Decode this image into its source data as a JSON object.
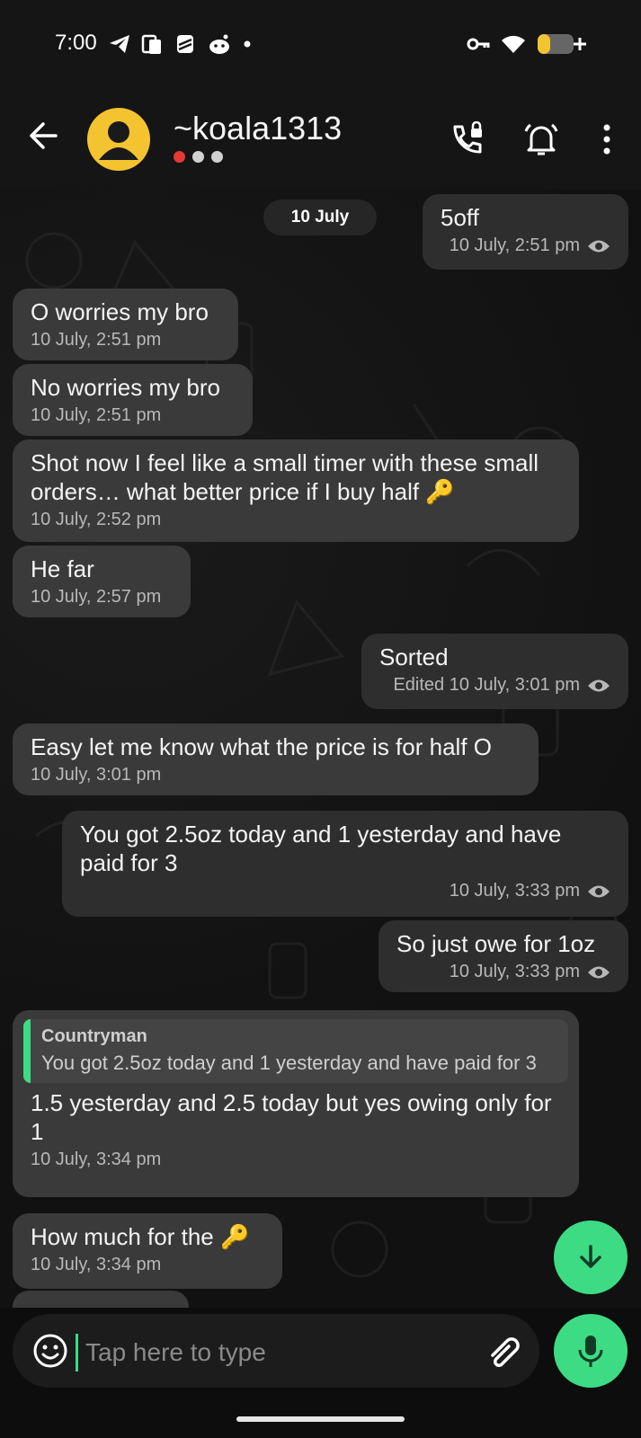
{
  "status_bar": {
    "time": "7:00"
  },
  "header": {
    "contact_name": "~koala1313"
  },
  "chat": {
    "date_chip": "10 July",
    "messages": [
      {
        "dir": "out",
        "text": "5off",
        "meta": "10 July, 2:51 pm",
        "seen": true
      },
      {
        "dir": "in",
        "text": "O worries my bro",
        "meta": "10 July, 2:51 pm"
      },
      {
        "dir": "in",
        "text": "No worries my bro",
        "meta": "10 July, 2:51 pm"
      },
      {
        "dir": "in",
        "text": "Shot now I feel like a small timer with these small orders… what better price if I buy half 🔑",
        "meta": "10 July, 2:52 pm"
      },
      {
        "dir": "in",
        "text": "He far",
        "meta": "10 July, 2:57 pm"
      },
      {
        "dir": "out",
        "text": "Sorted",
        "meta": "Edited 10 July, 3:01 pm",
        "seen": true
      },
      {
        "dir": "in",
        "text": "Easy let me know what the price is for half O",
        "meta": "10 July, 3:01 pm"
      },
      {
        "dir": "out",
        "text": "You got 2.5oz today and 1 yesterday and have paid for 3",
        "meta": "10 July, 3:33 pm",
        "seen": true
      },
      {
        "dir": "out",
        "text": "So just owe for 1oz",
        "meta": "10 July, 3:33 pm",
        "seen": true
      },
      {
        "dir": "in",
        "text": "1.5 yesterday and 2.5 today but yes owing only for 1",
        "meta": "10 July, 3:34 pm",
        "reply": {
          "author": "Countryman",
          "text": "You got 2.5oz today and 1 yesterday and have paid for 3"
        }
      },
      {
        "dir": "in",
        "text": "How much for the 🔑",
        "meta": "10 July, 3:34 pm"
      }
    ]
  },
  "composer": {
    "placeholder": "Tap here to type"
  },
  "colors": {
    "accent": "#3ddc84",
    "avatar": "#f4c430",
    "presence_red": "#e53935",
    "presence_grey": "#d0d0d0"
  }
}
